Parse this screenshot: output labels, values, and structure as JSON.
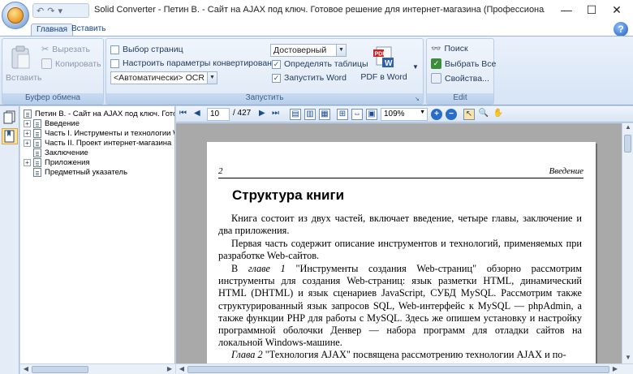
{
  "window": {
    "title": "Solid Converter - Петин В. - Сайт на AJAX под ключ. Готовое решение для интернет-магазина (Профессиональное программирование) - ...",
    "minimize": "—",
    "maximize": "☐",
    "close": "✕"
  },
  "ribbon": {
    "tabs": [
      "Главная",
      "Вставить"
    ],
    "clipboard": {
      "label": "Буфер обмена",
      "paste": "Вставить",
      "cut": "Вырезать",
      "copy": "Копировать"
    },
    "convert": {
      "label": "Запустить",
      "select_pages": "Выбор страниц",
      "conv_settings": "Настроить параметры конвертирования",
      "ocr_value": "<Автоматически> OCR",
      "mode_value": "Достоверный",
      "detect_tables": "Определять таблицы",
      "launch_word": "Запустить Word",
      "pdf_to_word": "PDF в Word"
    },
    "edit": {
      "label": "Edit",
      "find": "Поиск",
      "select_all": "Выбрать Все",
      "properties": "Свойства..."
    }
  },
  "tree": {
    "root": "Петин В. - Сайт на AJAX под ключ. Готовое",
    "items": [
      {
        "label": "Введение",
        "expandable": true
      },
      {
        "label": "Часть I. Инструменты и технологии We",
        "expandable": true
      },
      {
        "label": "Часть II. Проект интернет-магазина",
        "expandable": true
      },
      {
        "label": "Заключение",
        "expandable": false
      },
      {
        "label": "Приложения",
        "expandable": true
      },
      {
        "label": "Предметный указатель",
        "expandable": false
      }
    ]
  },
  "viewer": {
    "page_current": "10",
    "page_total": "/ 427",
    "zoom": "109%"
  },
  "page": {
    "number": "2",
    "section": "Введение",
    "title": "Структура книги",
    "p1": "Книга состоит из двух частей, включает введение, четыре главы, заключение и два приложения.",
    "p2": "Первая часть содержит описание инструментов и технологий, применяемых при разработке Web-сайтов.",
    "p3_lead": "В ",
    "p3_em": "главе 1",
    "p3_rest": " \"Инструменты создания Web-страниц\" обзорно рассмотрим инструменты для создания Web-страниц: язык разметки HTML, динамический HTML (DHTML) и язык сценариев JavaScript, СУБД MySQL. Рассмотрим также структурированный язык запросов SQL, Web-интерфейс к MySQL — phpAdmin, а также функции PHP для работы с MySQL. Здесь же опишем установку и настройку программной оболочки Денвер — набора программ для отладки сайтов на локальной Windows-машине.",
    "p4_em": "Глава 2",
    "p4_rest": " \"Технология AJAX\" посвящена рассмотрению технологии AJAX и по-"
  },
  "colors": {
    "ribbon_bg": "#dfe9f6",
    "viewer_bg": "#a9a9a9",
    "accent": "#15428b"
  }
}
